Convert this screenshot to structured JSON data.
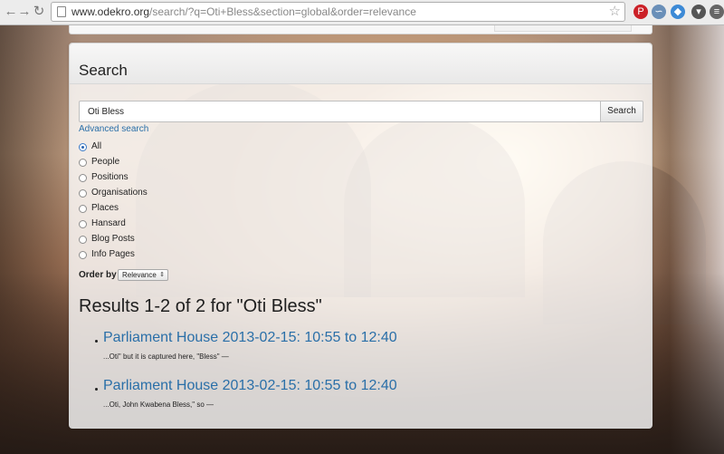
{
  "browser": {
    "url_host": "www.odekro.org",
    "url_path": "/search/?q=Oti+Bless&section=global&order=relevance",
    "back_glyph": "←",
    "forward_glyph": "→",
    "reload_glyph": "↻",
    "star_glyph": "☆",
    "extensions": [
      {
        "name": "pinterest-icon",
        "glyph": "P",
        "color": "#cb2027"
      },
      {
        "name": "wave-icon",
        "glyph": "∽",
        "color": "#6a8fb8"
      },
      {
        "name": "layers-icon",
        "glyph": "◆",
        "color": "#3d8ad6"
      },
      {
        "name": "pocket-icon",
        "glyph": "▾",
        "color": "#555555"
      },
      {
        "name": "menu-icon",
        "glyph": "≡",
        "color": "#666666"
      }
    ]
  },
  "search": {
    "title": "Search",
    "query": "Oti Bless",
    "button_label": "Search",
    "advanced_link": "Advanced search",
    "sections": [
      {
        "label": "All",
        "checked": true
      },
      {
        "label": "People",
        "checked": false
      },
      {
        "label": "Positions",
        "checked": false
      },
      {
        "label": "Organisations",
        "checked": false
      },
      {
        "label": "Places",
        "checked": false
      },
      {
        "label": "Hansard",
        "checked": false
      },
      {
        "label": "Blog Posts",
        "checked": false
      },
      {
        "label": "Info Pages",
        "checked": false
      }
    ],
    "order_label": "Order by",
    "order_value": "Relevance",
    "order_arrow": "⇕"
  },
  "results": {
    "heading": "Results 1-2 of 2 for \"Oti Bless\"",
    "items": [
      {
        "title": "Parliament House 2013-02-15: 10:55 to 12:40",
        "snippet": "...Oti\" but it is captured here, \"Bless\" —"
      },
      {
        "title": "Parliament House 2013-02-15: 10:55 to 12:40",
        "snippet": "...Oti, John Kwabena Bless,\" so —"
      }
    ]
  },
  "colors": {
    "link": "#2a6fa8",
    "radio_checked": "#2a64b0"
  }
}
